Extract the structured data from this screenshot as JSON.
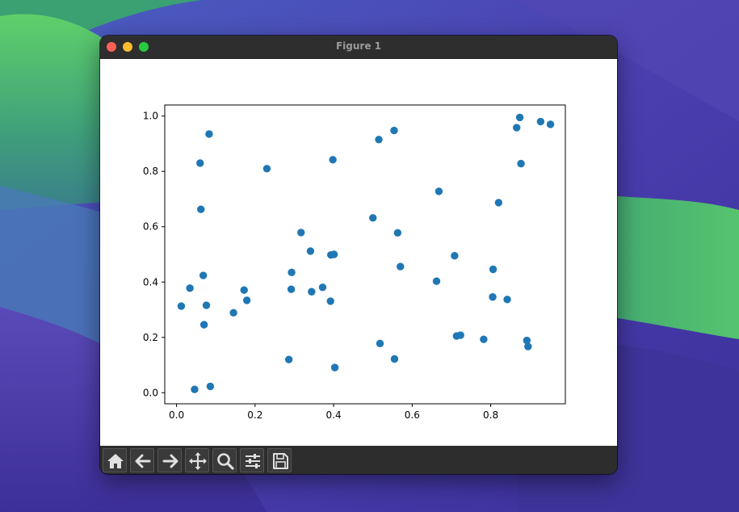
{
  "window": {
    "title": "Figure 1"
  },
  "toolbar": {
    "buttons": [
      {
        "name": "home",
        "icon": "home-icon"
      },
      {
        "name": "back",
        "icon": "arrow-left-icon"
      },
      {
        "name": "forward",
        "icon": "arrow-right-icon"
      },
      {
        "name": "pan",
        "icon": "move-icon"
      },
      {
        "name": "zoom",
        "icon": "magnifier-icon"
      },
      {
        "name": "configure-subplots",
        "icon": "sliders-icon"
      },
      {
        "name": "save",
        "icon": "floppy-disk-icon"
      }
    ]
  },
  "colors": {
    "marker": "#1f77b4",
    "canvas": "#ffffff",
    "toolbar": "#2d2d2d"
  },
  "chart_data": {
    "type": "scatter",
    "title": "",
    "xlabel": "",
    "ylabel": "",
    "xlim": [
      -0.03,
      0.99
    ],
    "ylim": [
      -0.04,
      1.04
    ],
    "xticks": [
      0.0,
      0.2,
      0.4,
      0.6,
      0.8
    ],
    "xtick_labels": [
      "0.0",
      "0.2",
      "0.4",
      "0.6",
      "0.8"
    ],
    "yticks": [
      0.0,
      0.2,
      0.4,
      0.6,
      0.8,
      1.0
    ],
    "ytick_labels": [
      "0.0",
      "0.2",
      "0.4",
      "0.6",
      "0.8",
      "1.0"
    ],
    "grid": false,
    "points": [
      {
        "x": 0.012,
        "y": 0.313
      },
      {
        "x": 0.034,
        "y": 0.378
      },
      {
        "x": 0.046,
        "y": 0.012
      },
      {
        "x": 0.06,
        "y": 0.83
      },
      {
        "x": 0.062,
        "y": 0.663
      },
      {
        "x": 0.068,
        "y": 0.424
      },
      {
        "x": 0.07,
        "y": 0.246
      },
      {
        "x": 0.076,
        "y": 0.316
      },
      {
        "x": 0.083,
        "y": 0.935
      },
      {
        "x": 0.086,
        "y": 0.023
      },
      {
        "x": 0.145,
        "y": 0.289
      },
      {
        "x": 0.172,
        "y": 0.371
      },
      {
        "x": 0.179,
        "y": 0.334
      },
      {
        "x": 0.23,
        "y": 0.81
      },
      {
        "x": 0.286,
        "y": 0.12
      },
      {
        "x": 0.292,
        "y": 0.374
      },
      {
        "x": 0.293,
        "y": 0.435
      },
      {
        "x": 0.317,
        "y": 0.579
      },
      {
        "x": 0.341,
        "y": 0.512
      },
      {
        "x": 0.344,
        "y": 0.365
      },
      {
        "x": 0.372,
        "y": 0.381
      },
      {
        "x": 0.392,
        "y": 0.331
      },
      {
        "x": 0.393,
        "y": 0.498
      },
      {
        "x": 0.398,
        "y": 0.842
      },
      {
        "x": 0.401,
        "y": 0.5
      },
      {
        "x": 0.403,
        "y": 0.091
      },
      {
        "x": 0.5,
        "y": 0.632
      },
      {
        "x": 0.515,
        "y": 0.915
      },
      {
        "x": 0.518,
        "y": 0.178
      },
      {
        "x": 0.554,
        "y": 0.948
      },
      {
        "x": 0.555,
        "y": 0.122
      },
      {
        "x": 0.563,
        "y": 0.578
      },
      {
        "x": 0.57,
        "y": 0.456
      },
      {
        "x": 0.662,
        "y": 0.403
      },
      {
        "x": 0.668,
        "y": 0.728
      },
      {
        "x": 0.708,
        "y": 0.495
      },
      {
        "x": 0.713,
        "y": 0.205
      },
      {
        "x": 0.723,
        "y": 0.208
      },
      {
        "x": 0.782,
        "y": 0.193
      },
      {
        "x": 0.805,
        "y": 0.346
      },
      {
        "x": 0.806,
        "y": 0.446
      },
      {
        "x": 0.82,
        "y": 0.687
      },
      {
        "x": 0.842,
        "y": 0.337
      },
      {
        "x": 0.866,
        "y": 0.958
      },
      {
        "x": 0.874,
        "y": 0.995
      },
      {
        "x": 0.877,
        "y": 0.828
      },
      {
        "x": 0.892,
        "y": 0.189
      },
      {
        "x": 0.895,
        "y": 0.167
      },
      {
        "x": 0.927,
        "y": 0.98
      },
      {
        "x": 0.952,
        "y": 0.97
      }
    ]
  }
}
